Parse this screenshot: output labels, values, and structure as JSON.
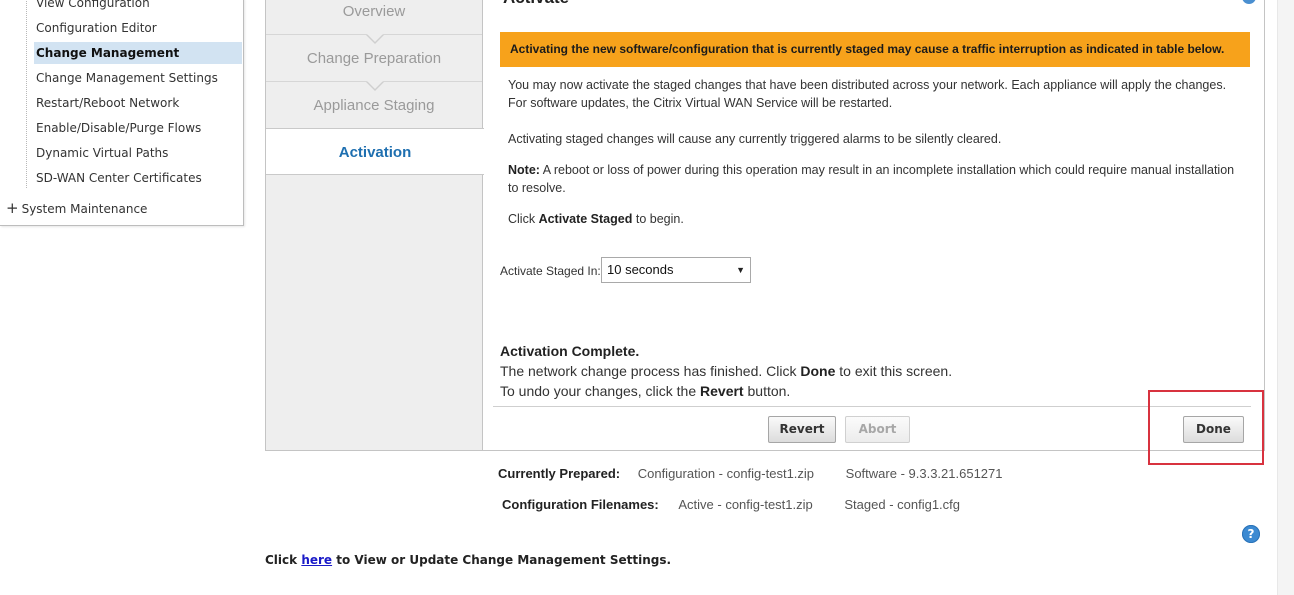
{
  "nav": {
    "items": [
      {
        "label": "View Configuration"
      },
      {
        "label": "Configuration Editor"
      },
      {
        "label": "Change Management"
      },
      {
        "label": "Change Management Settings"
      },
      {
        "label": "Restart/Reboot Network"
      },
      {
        "label": "Enable/Disable/Purge Flows"
      },
      {
        "label": "Dynamic Virtual Paths"
      },
      {
        "label": "SD-WAN Center Certificates"
      }
    ],
    "active_item": "Change Management",
    "group": {
      "expander": "+",
      "label": "System Maintenance"
    }
  },
  "wizard": {
    "steps": [
      {
        "label": "Overview"
      },
      {
        "label": "Change Preparation"
      },
      {
        "label": "Appliance Staging"
      },
      {
        "label": "Activation"
      }
    ],
    "active_step": "Activation"
  },
  "activate": {
    "title": "Activate",
    "warning": "Activating the new software/configuration that is currently staged may cause a traffic interruption as indicated in table below.",
    "intro": "You may now activate the staged changes that have been distributed across your network. Each appliance will apply the changes. For software updates, the Citrix Virtual WAN Service will be restarted.",
    "alarms": "Activating staged changes will cause any currently triggered alarms to be silently cleared.",
    "note_label": "Note:",
    "note_text": "A reboot or loss of power during this operation may result in an incomplete installation which could require manual installation to resolve.",
    "click_prefix": "Click",
    "click_action": "Activate Staged",
    "click_suffix": "to begin.",
    "select_label": "Activate Staged In:",
    "select_value": "10 seconds",
    "complete_title": "Activation Complete.",
    "complete_line1_prefix": "The network change process has finished. Click",
    "complete_line1_action": "Done",
    "complete_line1_suffix": "to exit this screen.",
    "complete_line2_prefix": "To undo your changes, click the",
    "complete_line2_action": "Revert",
    "complete_line2_suffix": "button.",
    "buttons": {
      "revert": "Revert",
      "abort": "Abort",
      "done": "Done"
    }
  },
  "info": {
    "prepared_label": "Currently Prepared:",
    "prepared_config": "Configuration - config-test1.zip",
    "prepared_software": "Software - 9.3.3.21.651271",
    "filenames_label": "Configuration Filenames:",
    "active_file": "Active - config-test1.zip",
    "staged_file": "Staged - config1.cfg"
  },
  "footer": {
    "prefix": "Click",
    "link": "here",
    "suffix": "to View or Update Change Management Settings."
  },
  "help": {
    "glyph": "?"
  },
  "colors": {
    "warning_bg": "#f7a21b",
    "active_step": "#1e6fb0",
    "nav_highlight": "#d2e3f2",
    "focus_box": "#d8323f",
    "link": "#1a1ac8"
  }
}
